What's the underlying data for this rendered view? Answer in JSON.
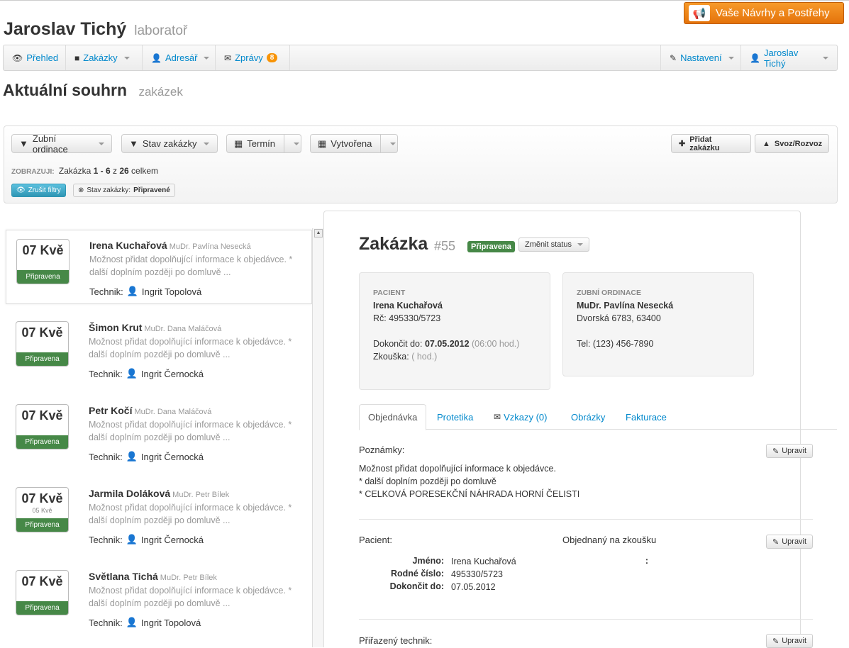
{
  "feedback": {
    "label": "Vaše Návrhy a Postřehy",
    "icon": "megaphone-icon"
  },
  "header": {
    "name": "Jaroslav Tichý",
    "role": "laboratoř"
  },
  "nav": {
    "items": [
      {
        "label": "Přehled",
        "icon": "eye-icon"
      },
      {
        "label": "Zakázky",
        "icon": "book-icon"
      },
      {
        "label": "Adresář",
        "icon": "user-icon"
      },
      {
        "label": "Zprávy",
        "icon": "envelope-icon",
        "badge": "8"
      }
    ],
    "right": [
      {
        "label": "Nastavení",
        "icon": "pencil-icon"
      },
      {
        "label": "Jaroslav Tichý",
        "icon": "user-icon"
      }
    ]
  },
  "page": {
    "title": "Aktuální souhrn",
    "subtitle": "zakázek"
  },
  "filters": {
    "buttons": [
      "Zubní ordinace",
      "Stav zakázky",
      "Termín",
      "Vytvořena"
    ],
    "add_order": "Přidat zakázku",
    "pickup": "Svoz/Rozvoz",
    "showing_label": "ZOBRAZUJI:",
    "showing_prefix": "Zakázka",
    "showing_range": "1 - 6",
    "showing_of": "z",
    "showing_total": "26",
    "showing_suffix": "celkem",
    "cancel_filters": "Zrušit filtry",
    "active_filter_label": "Stav zakázky:",
    "active_filter_value": "Připravené"
  },
  "orders": [
    {
      "date": "07 Kvě",
      "sub": "",
      "status": "Připravena",
      "patient": "Irena Kuchařová",
      "doctor": "MuDr. Pavlína Nesecká",
      "desc": "Možnost přidat dopolňující informace k objedávce. * další doplním později po domluvě ...",
      "tech_label": "Technik:",
      "tech": "Ingrit Topolová"
    },
    {
      "date": "07 Kvě",
      "sub": "",
      "status": "Připravena",
      "patient": "Šimon Krut",
      "doctor": "MuDr. Dana Maláčová",
      "desc": "Možnost přidat dopolňující informace k objedávce. * další doplním později po domluvě ...",
      "tech_label": "Technik:",
      "tech": "Ingrit Černocká"
    },
    {
      "date": "07 Kvě",
      "sub": "",
      "status": "Připravena",
      "patient": "Petr Kočí",
      "doctor": "MuDr. Dana Maláčová",
      "desc": "Možnost přidat dopolňující informace k objedávce. * další doplním později po domluvě ...",
      "tech_label": "Technik:",
      "tech": "Ingrit Černocká"
    },
    {
      "date": "07 Kvě",
      "sub": "05 Kvě",
      "status": "Připravena",
      "patient": "Jarmila Doláková",
      "doctor": "MuDr. Petr Bílek",
      "desc": "Možnost přidat dopolňující informace k objedávce. * další doplním později po domluvě ...",
      "tech_label": "Technik:",
      "tech": "Ingrit Černocká"
    },
    {
      "date": "07 Kvě",
      "sub": "",
      "status": "Připravena",
      "patient": "Světlana Tichá",
      "doctor": "MuDr. Petr Bílek",
      "desc": "Možnost přidat dopolňující informace k objedávce. * další doplním později po domluvě ...",
      "tech_label": "Technik:",
      "tech": "Ingrit Topolová"
    }
  ],
  "detail": {
    "title": "Zakázka",
    "number": "#55",
    "status": "Připravena",
    "change_status": "Změnit status",
    "patient_box": {
      "caption": "PACIENT",
      "name": "Irena Kuchařová",
      "rc": "Rč: 495330/5723",
      "finish_label": "Dokončit do:",
      "finish_date": "07.05.2012",
      "finish_time": "(06:00 hod.)",
      "try_label": "Zkouška:",
      "try_value": "( hod.)"
    },
    "clinic_box": {
      "caption": "ZUBNÍ ORDINACE",
      "name": "MuDr. Pavlína Nesecká",
      "address": "Dvorská 6783, 63400",
      "tel": "Tel: (123) 456-7890"
    },
    "tabs": [
      {
        "label": "Objednávka"
      },
      {
        "label": "Protetika"
      },
      {
        "label": "Vzkazy (0)",
        "icon": "envelope-icon"
      },
      {
        "label": "Obrázky"
      },
      {
        "label": "Fakturace"
      }
    ],
    "notes_label": "Poznámky:",
    "edit_label": "Upravit",
    "notes_lines": [
      "Možnost přidat dopolňující informace k objedávce.",
      "* další doplním později po domluvě",
      "* CELKOVÁ PORESEKČNÍ NÁHRADA HORNÍ ČELISTI"
    ],
    "patient_label": "Pacient:",
    "ordered_try_label": "Objednaný na zkoušku",
    "kv": [
      {
        "key": "Jméno:",
        "value": "Irena Kuchařová"
      },
      {
        "key": "Rodné číslo:",
        "value": "495330/5723"
      },
      {
        "key": "Dokončit do:",
        "value": "07.05.2012"
      }
    ],
    "colon_only": ":",
    "assigned_tech_label": "Přiřazený technik:"
  }
}
